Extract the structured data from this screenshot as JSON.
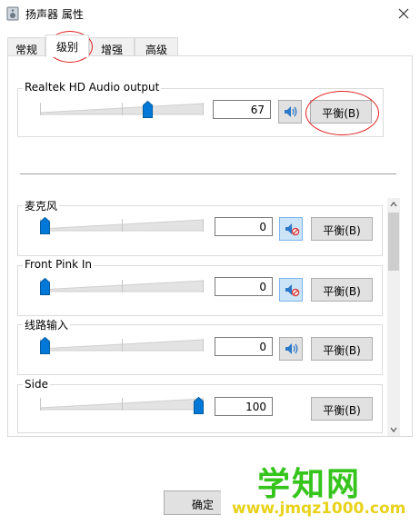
{
  "window": {
    "title": "扬声器 属性"
  },
  "tabs": [
    {
      "label": "常规"
    },
    {
      "label": "级别"
    },
    {
      "label": "增强"
    },
    {
      "label": "高级"
    }
  ],
  "active_tab": "级别",
  "main": {
    "label": "Realtek HD Audio output",
    "value": "67",
    "level_percent": 67,
    "muted": false,
    "balance_label": "平衡(B)"
  },
  "inputs": [
    {
      "label": "麦克风",
      "value": "0",
      "level_percent": 0,
      "muted": true,
      "balance_label": "平衡(B)"
    },
    {
      "label": "Front Pink In",
      "value": "0",
      "level_percent": 0,
      "muted": true,
      "balance_label": "平衡(B)"
    },
    {
      "label": "线路输入",
      "value": "0",
      "level_percent": 0,
      "muted": false,
      "balance_label": "平衡(B)"
    },
    {
      "label": "Side",
      "value": "100",
      "level_percent": 100,
      "muted": false,
      "balance_label": "平衡(B)"
    }
  ],
  "footer": {
    "ok_label": "确定"
  },
  "watermark": {
    "text": "学知网",
    "url": "www.jmqz1000.com"
  },
  "colors": {
    "accent": "#0078d7",
    "annotation": "#e02020",
    "watermark_green": "#35c41b",
    "watermark_yellow": "#e8d21a"
  }
}
